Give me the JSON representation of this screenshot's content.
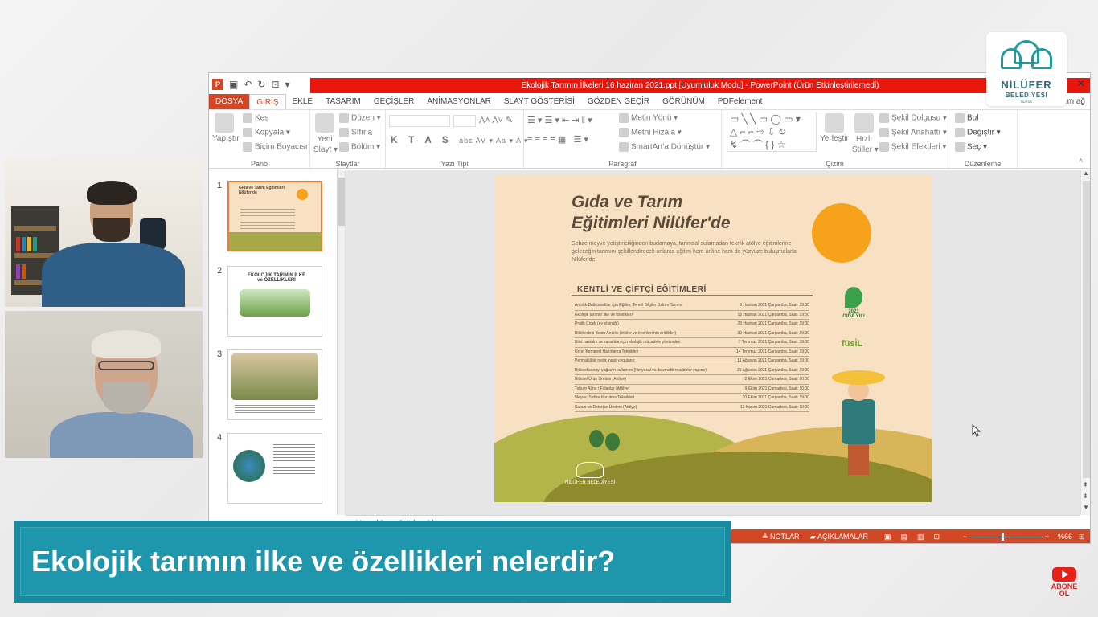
{
  "powerpoint": {
    "window_title": "Ekolojik Tarımın İlkeleri 16 haziran 2021.ppt [Uyumluluk Modu] - PowerPoint (Ürün Etkinleştirilemedi)",
    "help": "?",
    "close": "✕",
    "account_fragment": "rum ağ",
    "tabs": [
      "DOSYA",
      "GİRİŞ",
      "EKLE",
      "TASARIM",
      "GEÇİŞLER",
      "ANİMASYONLAR",
      "SLAYT GÖSTERİSİ",
      "GÖZDEN GEÇİR",
      "GÖRÜNÜM",
      "PDFelement"
    ],
    "ribbon": {
      "pano": {
        "label": "Pano",
        "paste": "Yapıştır",
        "cut": "Kes",
        "copy": "Kopyala",
        "format_painter": "Biçim Boyacısı"
      },
      "slaytlar": {
        "label": "Slaytlar",
        "new_slide_1": "Yeni",
        "new_slide_2": "Slayt",
        "layout": "Düzen",
        "reset": "Sıfırla",
        "section": "Bölüm"
      },
      "yazi_tipi": {
        "label": "Yazı Tipi"
      },
      "paragraf": {
        "label": "Paragraf",
        "text_direction": "Metin Yönü",
        "align_text": "Metni Hizala",
        "smartart": "SmartArt'a Dönüştür"
      },
      "cizim": {
        "label": "Çizim",
        "arrange": "Yerleştir",
        "quick_1": "Hızlı",
        "quick_2": "Stiller",
        "fill": "Şekil Dolgusu",
        "outline": "Şekil Anahattı",
        "effects": "Şekil Efektleri"
      },
      "duzenleme": {
        "label": "Düzenleme",
        "find": "Bul",
        "replace": "Değiştir",
        "select": "Seç"
      }
    },
    "thumbnails": [
      {
        "num": "1",
        "title": "Gıda ve Tarım Eğitimleri Nilüfer'de"
      },
      {
        "num": "2",
        "title": "EKOLOJİK TARIMIN İLKE ve ÖZELLİKLERİ"
      },
      {
        "num": "3",
        "title": ""
      },
      {
        "num": "4",
        "title": ""
      }
    ],
    "notes_placeholder": "Not eklemek için tıklatın",
    "status": {
      "notes": "NOTLAR",
      "comments": "AÇIKLAMALAR",
      "zoom": "%66",
      "minus": "−",
      "plus": "+"
    }
  },
  "slide": {
    "title_line1": "Gıda ve Tarım",
    "title_line2": "Eğitimleri Nilüfer'de",
    "subtitle": "Sebze meyve yetiştiriciliğinden budamaya, tarımsal sulamadan teknik atölye eğitimlerine geleceğin tarımını şekillendirecek onlarca eğitim hem online hem de yüzyüze buluşmalarla Nilüfer'de.",
    "section": "KENTLİ VE ÇİFTÇİ EĞİTİMLERİ",
    "rows": [
      {
        "name": "Arıcılık Ballıcavaklar için Eğitim, Temel Bilgiler Bakım Tanımı",
        "date": "9 Haziran 2021 Çarşamba, Saat: 19:00"
      },
      {
        "name": "Ekolojik tarımın ilke ve özellikleri",
        "date": "16 Haziran 2021 Çarşamba, Saat: 19:00"
      },
      {
        "name": "Pratik Çiçek (ev etkinliği)",
        "date": "23 Haziran 2021 Çarşamba, Saat: 19:00"
      },
      {
        "name": "Bitkilerdeki Besin Arıcılık (etkiler ve önerilerimin eriklikler)",
        "date": "30 Haziran 2021 Çarşamba, Saat: 19:00"
      },
      {
        "name": "Bitki hastalık ve zararlıları için ekolojik mücadele yöntemleri",
        "date": "7 Temmuz 2021 Çarşamba, Saat: 19:00"
      },
      {
        "name": "Ücret Kompost Hazırlama Teknikleri",
        "date": "14 Temmuz 2021 Çarşamba, Saat: 19:00"
      },
      {
        "name": "Permakültür nedir, nasıl uygulanır",
        "date": "11 Ağustos 2021 Çarşamba, Saat: 19:00"
      },
      {
        "name": "Bitkisel sanayi yağların kullanımı (kimyasal vs. kozmetik maddeler yapımı)",
        "date": "25 Ağustos 2021 Çarşamba, Saat: 19:00"
      },
      {
        "name": "Bitkisel Ürün Üretimi (Atölye)",
        "date": "2 Ekim 2021 Cumartesi, Saat: 10:00"
      },
      {
        "name": "Tohum Alma / Fidanlar (Atölye)",
        "date": "9 Ekim 2021 Cumartesi, Saat: 10:00"
      },
      {
        "name": "Meyve, Sebze Kurutma Teknikleri",
        "date": "20 Ekim 2021 Çarşamba, Saat: 19:00"
      },
      {
        "name": "Sabun ve Deterjan Üretimi (Atölye)",
        "date": "13 Kasım 2021 Cumartesi, Saat: 10:00"
      }
    ],
    "badge_year": "2021",
    "badge_text": "GIDA YILI",
    "fusil": "füsİL",
    "footer_logo": "NİLÜFER BELEDİYESİ"
  },
  "logo": {
    "line1": "NİLÜFER",
    "line2": "BELEDİYESİ",
    "line3": "BURSA"
  },
  "banner": {
    "text": "Ekolojik tarımın ilke ve özellikleri nelerdir?"
  },
  "abone": {
    "line1": "ABONE",
    "line2": "OL"
  },
  "colors": {
    "accent": "#d24726",
    "title_red": "#e8170e",
    "banner": "#1a8aa0",
    "sun": "#f7a21b"
  }
}
